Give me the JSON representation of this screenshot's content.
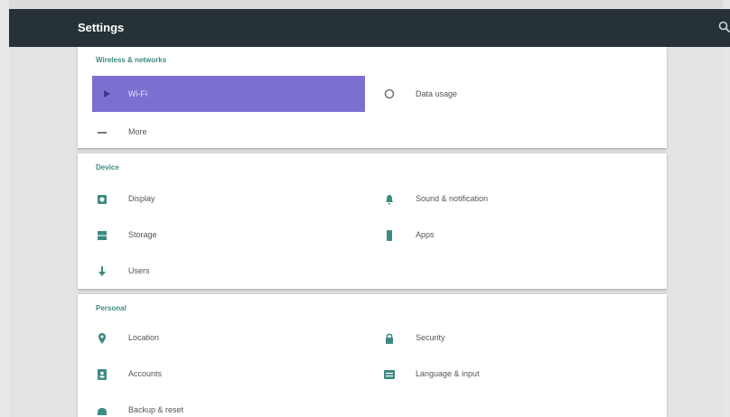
{
  "app": {
    "title": "Settings"
  },
  "sections": {
    "wireless": {
      "header": "Wireless & networks",
      "items": [
        {
          "label": "Wi-Fi",
          "icon": "wifi-icon",
          "selected": true
        },
        {
          "label": "Data usage",
          "icon": "data-usage-icon"
        },
        {
          "label": "More",
          "icon": "more-icon"
        }
      ]
    },
    "device": {
      "header": "Device",
      "items": [
        {
          "label": "Display",
          "icon": "display-icon"
        },
        {
          "label": "Sound & notification",
          "icon": "sound-icon"
        },
        {
          "label": "Storage",
          "icon": "storage-icon"
        },
        {
          "label": "Apps",
          "icon": "apps-icon"
        },
        {
          "label": "Users",
          "icon": "users-icon"
        }
      ]
    },
    "personal": {
      "header": "Personal",
      "items": [
        {
          "label": "Location",
          "icon": "location-icon"
        },
        {
          "label": "Security",
          "icon": "security-icon"
        },
        {
          "label": "Accounts",
          "icon": "accounts-icon"
        },
        {
          "label": "Language & input",
          "icon": "language-icon"
        },
        {
          "label": "Backup & reset",
          "icon": "backup-icon"
        }
      ]
    }
  },
  "colors": {
    "topbar": "#263238",
    "accent": "#3d8a82",
    "selected": "#7b6fd1"
  }
}
